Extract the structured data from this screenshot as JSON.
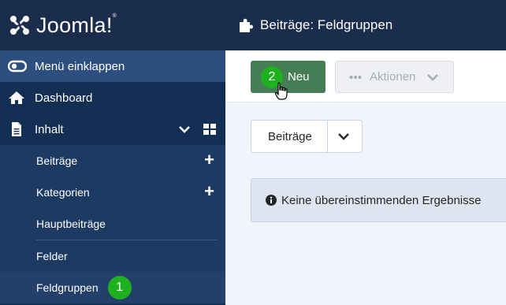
{
  "brand": {
    "name": "Joomla!",
    "trademark": "®"
  },
  "header": {
    "title": "Beiträge: Feldgruppen"
  },
  "sidebar": {
    "collapse_label": "Menü einklappen",
    "dashboard_label": "Dashboard",
    "content_label": "Inhalt",
    "sub_items": [
      {
        "label": "Beiträge",
        "has_add": true
      },
      {
        "label": "Kategorien",
        "has_add": true
      },
      {
        "label": "Hauptbeiträge",
        "has_add": false
      },
      {
        "label": "Felder",
        "has_add": false
      },
      {
        "label": "Feldgruppen",
        "has_add": false,
        "active": true
      }
    ],
    "add_symbol": "+",
    "step_badge": "1"
  },
  "toolbar": {
    "new_label": "Neu",
    "new_badge": "2",
    "actions_label": "Aktionen"
  },
  "filter": {
    "selected": "Beiträge"
  },
  "alert": {
    "message": "Keine übereinstimmenden Ergebnisse"
  },
  "colors": {
    "sidebar_bg": "#132f53",
    "header_bg": "#1a2d4c",
    "collapse_bg": "#2d4f7f",
    "new_button": "#457d54",
    "badge": "#1fb01f"
  },
  "icons": [
    "joomla-logo-icon",
    "puzzle-icon",
    "toggle-icon",
    "home-icon",
    "file-icon",
    "chevron-down-icon",
    "grid-icon",
    "plus-icon",
    "ellipsis-icon",
    "info-icon",
    "hand-cursor-icon"
  ]
}
